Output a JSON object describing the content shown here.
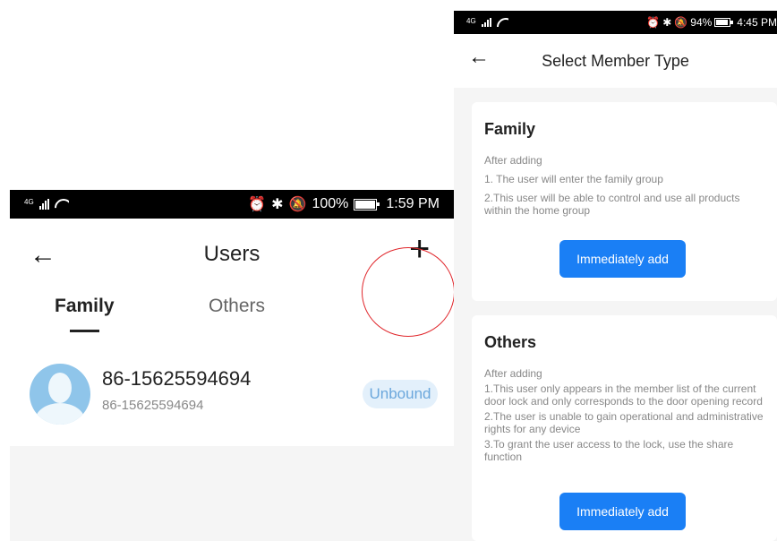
{
  "left_screen": {
    "status_bar": {
      "network": "4G",
      "battery": "100%",
      "battery_level": 1.0,
      "time": "1:59 PM"
    },
    "header": {
      "title": "Users",
      "back_icon": "arrow-left-icon",
      "add_icon": "plus-icon"
    },
    "tabs": [
      {
        "label": "Family",
        "active": true
      },
      {
        "label": "Others",
        "active": false
      }
    ],
    "users": [
      {
        "name": "86-15625594694",
        "subtitle": "86-15625594694",
        "status": "Unbound"
      }
    ],
    "annotation_color": "#e0262b"
  },
  "right_screen": {
    "status_bar": {
      "network": "4G",
      "battery": "94%",
      "battery_level": 0.94,
      "time": "4:45 PM"
    },
    "header": {
      "title": "Select Member Type",
      "back_icon": "arrow-left-icon"
    },
    "cards": [
      {
        "title": "Family",
        "lines": [
          "After adding",
          "1. The user will enter the family group",
          "2.This user will be able to control and use all products within the home group"
        ],
        "button": "Immediately add"
      },
      {
        "title": "Others",
        "lines": [
          "After adding",
          "1.This user only appears in the member list of the current door lock and only corresponds to the door opening record",
          "2.The user is unable to gain operational and administrative rights for any device",
          "3.To grant the user access to the lock, use the share function"
        ],
        "button": "Immediately add"
      }
    ],
    "accent_color": "#1a7ff5"
  }
}
